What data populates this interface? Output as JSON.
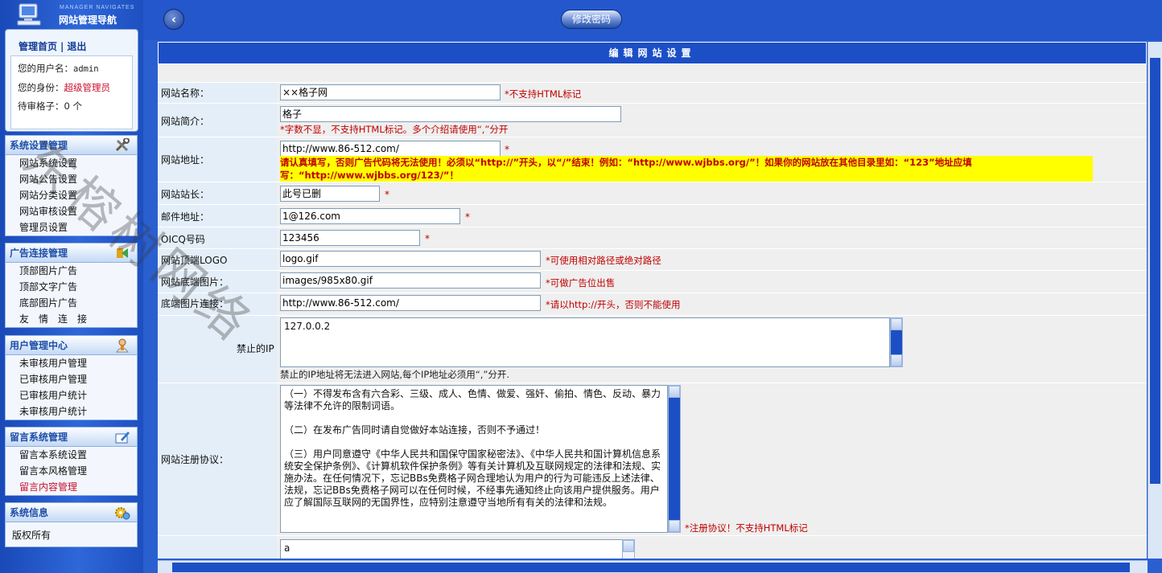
{
  "sidebar": {
    "logo_caption": "MANAGER NAVIGATES",
    "logo_title": "网站管理导航",
    "user_box": {
      "home_link": "管理首页",
      "separator": "|",
      "logout_link": "退出",
      "username_label": "您的用户名：",
      "username": "admin",
      "role_label": "您的身份：",
      "role": "超级管理员",
      "pending_label": "待审格子：",
      "pending_count": "0",
      "pending_unit": "个"
    },
    "sections": [
      {
        "title": "系统设置管理",
        "items": [
          "网站系统设置",
          "网站公告设置",
          "网站分类设置",
          "网站审核设置",
          "管理员设置"
        ]
      },
      {
        "title": "广告连接管理",
        "items": [
          "顶部图片广告",
          "顶部文字广告",
          "底部图片广告",
          "友　情　连　接"
        ]
      },
      {
        "title": "用户管理中心",
        "items": [
          "未审核用户管理",
          "已审核用户管理",
          "已审核用户统计",
          "未审核用户统计"
        ]
      },
      {
        "title": "留言系统管理",
        "items": [
          "留言本系统设置",
          "留言本风格管理",
          "留言内容管理"
        ]
      },
      {
        "title": "系统信息",
        "items": [
          "版权所有"
        ]
      }
    ]
  },
  "toolbar": {
    "back_icon": "left-arrow",
    "change_password_label": "修改密码"
  },
  "form": {
    "title": "编辑网站设置",
    "site_name": {
      "label": "网站名称：",
      "value": "××格子网",
      "note": "*不支持HTML标记"
    },
    "site_intro": {
      "label": "网站简介：",
      "value": "格子",
      "note": "*字数不显，不支持HTML标记。多个介绍请使用“,”分开"
    },
    "site_url": {
      "label": "网站地址：",
      "value": "http://www.86-512.com/",
      "star": "*",
      "warning": "请认真填写，否则广告代码将无法使用！必须以“http://”开头，以“/”结束！例如：“http://www.wjbbs.org/”！如果你的网站放在其他目录里如：“123”地址应填写：“http://www.wjbbs.org/123/”！"
    },
    "webmaster": {
      "label": "网站站长：",
      "value": "此号已删",
      "star": "*"
    },
    "email": {
      "label": "邮件地址：",
      "value": "1@126.com",
      "star": "*"
    },
    "qq": {
      "label": "OICQ号码",
      "value": "123456",
      "star": "*"
    },
    "top_logo": {
      "label": "网站顶端LOGO",
      "value": "logo.gif",
      "note": "*可使用相对路径或绝对路径"
    },
    "bottom_image": {
      "label": "网站底端图片：",
      "value": "images/985x80.gif",
      "note": "*可做广告位出售"
    },
    "bottom_link": {
      "label": "底端图片连接：",
      "value": "http://www.86-512.com/",
      "note": "*请以http://开头，否则不能使用"
    },
    "banned_ip": {
      "label": "禁止的IP",
      "value": "127.0.0.2",
      "note": "禁止的IP地址将无法进入网站,每个IP地址必须用“,”分开."
    },
    "agreement": {
      "label": "网站注册协议：",
      "value": "（一）不得发布含有六合彩、三级、成人、色情、做爱、强奸、偷拍、情色、反动、暴力等法律不允许的限制词语。\n\n（二）在发布广告同时请自觉做好本站连接，否则不予通过！\n\n（三）用户同意遵守《中华人民共和国保守国家秘密法》、《中华人民共和国计算机信息系统安全保护条例》、《计算机软件保护条例》等有关计算机及互联网规定的法律和法规、实施办法。在任何情况下，忘记BBs免费格子网合理地认为用户的行为可能违反上述法律、法规，忘记BBs免费格子网可以在任何时候，不经事先通知终止向该用户提供服务。用户应了解国际互联网的无国界性，应特别注意遵守当地所有有关的法律和法规。",
      "note": "*注册协议！不支持HTML标记"
    },
    "last_field": {
      "value": "a"
    }
  },
  "watermark": "东榕树网络",
  "colors": {
    "accent": "#1c4ec6",
    "note_red": "#c00000",
    "highlight": "#ffff00"
  }
}
